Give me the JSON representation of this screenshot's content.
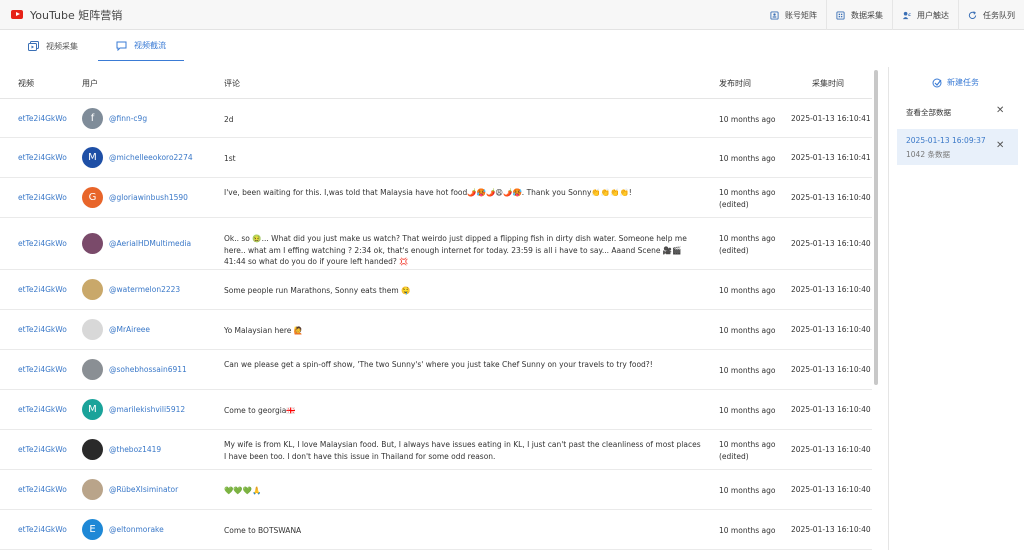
{
  "app": {
    "title": "YouTube 矩阵营销"
  },
  "nav": [
    {
      "label": "账号矩阵",
      "icon": "account-matrix-icon"
    },
    {
      "label": "数据采集",
      "icon": "data-collect-icon"
    },
    {
      "label": "用户触达",
      "icon": "user-reach-icon"
    },
    {
      "label": "任务队列",
      "icon": "task-queue-icon"
    }
  ],
  "tabs": [
    {
      "label": "视频采集",
      "active": false
    },
    {
      "label": "视频截流",
      "active": true
    }
  ],
  "table": {
    "headers": {
      "video": "视频",
      "user": "用户",
      "comment": "评论",
      "published": "发布时间",
      "collected": "采集时间"
    },
    "rows": [
      {
        "video": "etTe2i4GkWo",
        "avatar_letter": "f",
        "avatar_color": "#7f8c99",
        "user": "@finn-c9g",
        "comment": "2d",
        "published": "10 months ago",
        "edited": "",
        "collected": "2025-01-13 16:10:41"
      },
      {
        "video": "etTe2i4GkWo",
        "avatar_letter": "M",
        "avatar_color": "#1e4fa6",
        "user": "@michelleeokoro2274",
        "comment": "1st",
        "published": "10 months ago",
        "edited": "",
        "collected": "2025-01-13 16:10:41"
      },
      {
        "video": "etTe2i4GkWo",
        "avatar_letter": "G",
        "avatar_color": "#e8652a",
        "user": "@gloriawinbush1590",
        "comment": "I've, been waiting for this. I,was told that Malaysia have hot food🌶️🥵🌶️😩🌶️🥵. Thank you Sonny👏👏👏👏!",
        "published": "10 months ago",
        "edited": "(edited)",
        "collected": "2025-01-13 16:10:40"
      },
      {
        "video": "etTe2i4GkWo",
        "avatar_letter": "",
        "avatar_color": "#7a4a6a",
        "user": "@AerialHDMultimedia",
        "comment": "Ok.. so 🤢... What did you just make us watch? That weirdo just dipped a flipping fish in dirty dish water. Someone help me here.. what am I effing watching ? 2:34 ok, that's enough internet for today. 23:59 is all i have to say... Aaand Scene 🎥🎬 41:44 so what do you do if youre left handed? 💢",
        "published": "10 months ago",
        "edited": "(edited)",
        "collected": "2025-01-13 16:10:40"
      },
      {
        "video": "etTe2i4GkWo",
        "avatar_letter": "",
        "avatar_color": "#c9a86a",
        "user": "@watermelon2223",
        "comment": "Some people run Marathons, Sonny eats them 🤤",
        "published": "10 months ago",
        "edited": "",
        "collected": "2025-01-13 16:10:40"
      },
      {
        "video": "etTe2i4GkWo",
        "avatar_letter": "",
        "avatar_color": "#d8d8d8",
        "user": "@MrAireee",
        "comment": "Yo Malaysian here 🙋",
        "published": "10 months ago",
        "edited": "",
        "collected": "2025-01-13 16:10:40"
      },
      {
        "video": "etTe2i4GkWo",
        "avatar_letter": "",
        "avatar_color": "#8a8f94",
        "user": "@sohebhossain6911",
        "comment": "Can we please get a spin-off show, 'The two Sunny's' where you just take Chef Sunny on your travels to try food?!",
        "published": "10 months ago",
        "edited": "",
        "collected": "2025-01-13 16:10:40"
      },
      {
        "video": "etTe2i4GkWo",
        "avatar_letter": "M",
        "avatar_color": "#1aa39a",
        "user": "@marilekishvili5912",
        "comment": "Come to georgia🇬🇪",
        "published": "10 months ago",
        "edited": "",
        "collected": "2025-01-13 16:10:40"
      },
      {
        "video": "etTe2i4GkWo",
        "avatar_letter": "",
        "avatar_color": "#2a2a2a",
        "user": "@theboz1419",
        "comment": "My wife is from KL, I love Malaysian food. But, I always have issues eating in KL, I just can't past the cleanliness of most places I have been too. I don't have this issue in Thailand for some odd reason.",
        "published": "10 months ago",
        "edited": "(edited)",
        "collected": "2025-01-13 16:10:40"
      },
      {
        "video": "etTe2i4GkWo",
        "avatar_letter": "",
        "avatar_color": "#b9a48a",
        "user": "@RübeXIsiminator",
        "comment": "💚💚💚🙏",
        "published": "10 months ago",
        "edited": "",
        "collected": "2025-01-13 16:10:40"
      },
      {
        "video": "etTe2i4GkWo",
        "avatar_letter": "E",
        "avatar_color": "#1e88d6",
        "user": "@eltonmorake",
        "comment": "Come to BOTSWANA",
        "published": "10 months ago",
        "edited": "",
        "collected": "2025-01-13 16:10:40"
      }
    ]
  },
  "panel": {
    "new_task": "新建任务",
    "view_all": "查看全部数据",
    "task": {
      "date": "2025-01-13 16:09:37",
      "count": "1042 条数据"
    }
  },
  "colors": {
    "accent": "#3a7bd5",
    "link": "#3a78c8",
    "card_bg": "#e8f0fa"
  }
}
